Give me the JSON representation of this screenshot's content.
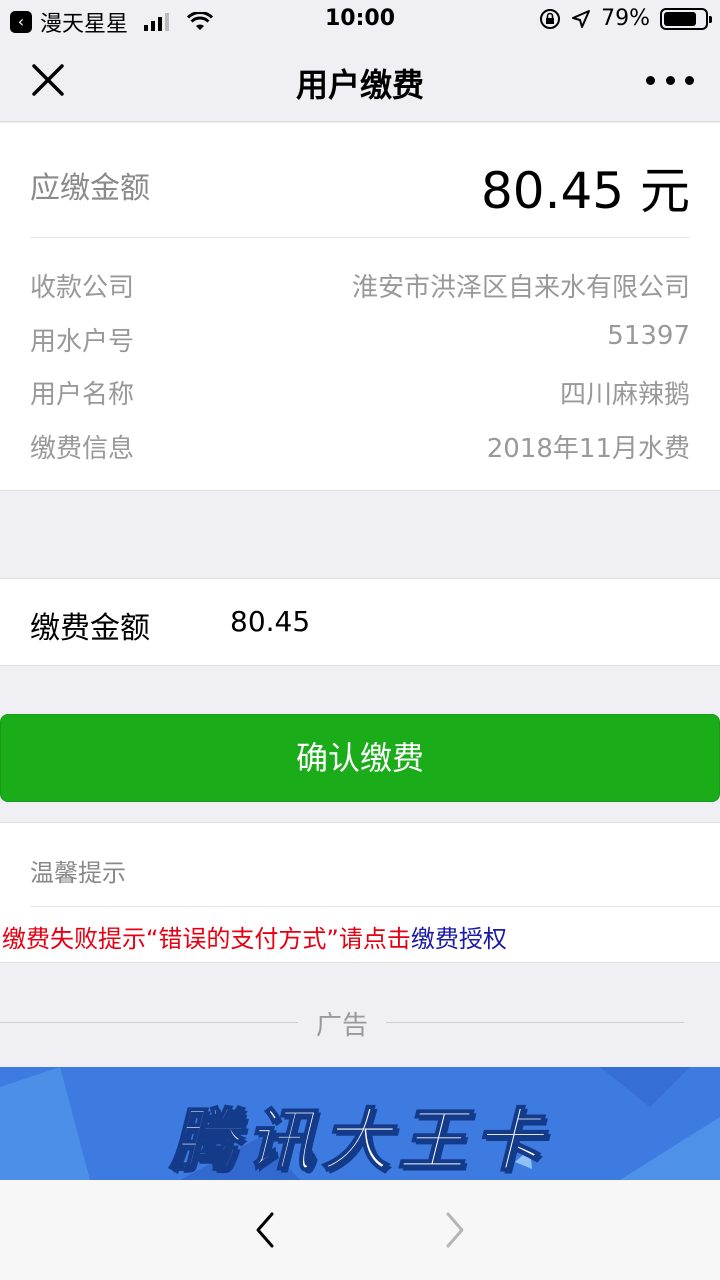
{
  "status_bar": {
    "carrier": "漫天星星",
    "time": "10:00",
    "battery": "79%",
    "battery_level": 0.79,
    "icons": [
      "back-to-app-icon",
      "signal-icon",
      "wifi-icon",
      "orientation-lock-icon",
      "location-icon",
      "battery-icon"
    ]
  },
  "nav": {
    "title": "用户缴费",
    "close_icon": "close-icon",
    "more_icon": "more-icon"
  },
  "bill": {
    "due_label": "应缴金额",
    "due_amount": "80.45 元",
    "rows": [
      {
        "label": "收款公司",
        "value": "淮安市洪泽区自来水有限公司"
      },
      {
        "label": "用水户号",
        "value": "51397"
      },
      {
        "label": "用户名称",
        "value": "四川麻辣鹅"
      },
      {
        "label": "缴费信息",
        "value": "2018年11月水费"
      }
    ]
  },
  "payment": {
    "label": "缴费金额",
    "value": "80.45"
  },
  "confirm_button": "确认缴费",
  "tips": {
    "heading": "温馨提示",
    "message": "缴费失败提示“错误的支付方式”请点击",
    "link": "缴费授权",
    "message_color": "#e60012",
    "link_color": "#1a1aa6"
  },
  "ad": {
    "label": "广告",
    "banner_text": "腾讯大王卡"
  },
  "bottom_nav": {
    "back_icon": "chevron-left-icon",
    "forward_icon": "chevron-right-icon"
  },
  "colors": {
    "accent_green": "#1aad19",
    "background": "#efeff4"
  }
}
